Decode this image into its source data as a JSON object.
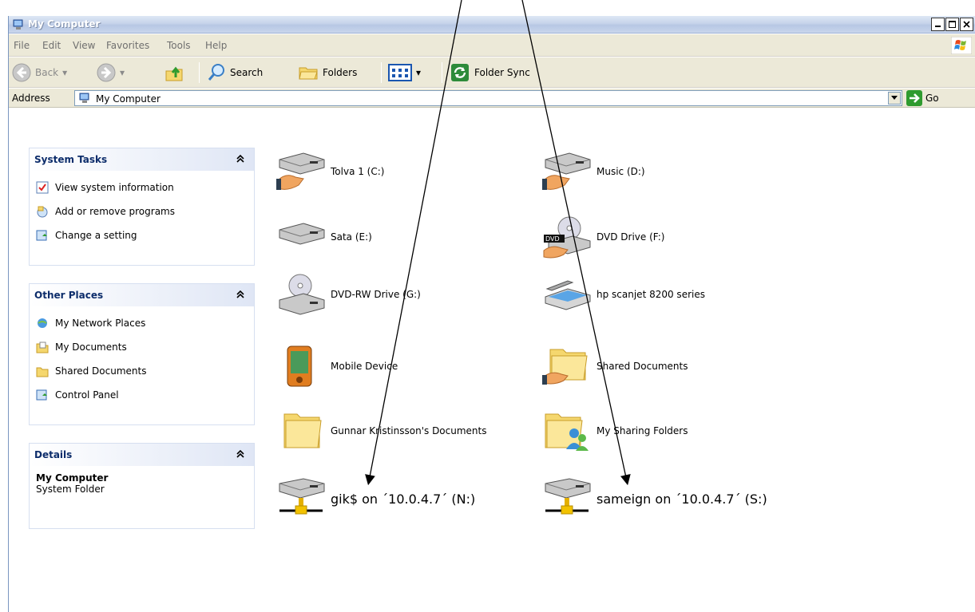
{
  "window": {
    "title": "My Computer"
  },
  "menu": [
    "File",
    "Edit",
    "View",
    "Favorites",
    "Tools",
    "Help"
  ],
  "toolbar": {
    "back": "Back",
    "search": "Search",
    "folders": "Folders",
    "folder_sync": "Folder Sync"
  },
  "address": {
    "label": "Address",
    "value": "My Computer",
    "go": "Go"
  },
  "system_tasks": {
    "title": "System Tasks",
    "items": [
      "View system information",
      "Add or remove programs",
      "Change a setting"
    ]
  },
  "other_places": {
    "title": "Other Places",
    "items": [
      "My Network Places",
      "My Documents",
      "Shared Documents",
      "Control Panel"
    ]
  },
  "details": {
    "title": "Details",
    "name": "My Computer",
    "type": "System Folder"
  },
  "items": [
    {
      "label": "Tolva 1  (C:)",
      "icon": "shared-drive-icon"
    },
    {
      "label": "Music  (D:)",
      "icon": "shared-drive-icon"
    },
    {
      "label": "Sata (E:)",
      "icon": "drive-icon"
    },
    {
      "label": "DVD Drive (F:)",
      "icon": "dvd-drive-icon"
    },
    {
      "label": "DVD-RW Drive (G:)",
      "icon": "cd-drive-icon"
    },
    {
      "label": "hp scanjet 8200 series",
      "icon": "scanner-icon"
    },
    {
      "label": "Mobile Device",
      "icon": "pda-icon"
    },
    {
      "label": "Shared Documents",
      "icon": "shared-folder-icon"
    },
    {
      "label": "Gunnar Kristinsson's Documents",
      "icon": "folder-icon"
    },
    {
      "label": "My Sharing Folders",
      "icon": "sharing-folder-icon"
    },
    {
      "label": "gik$ on ´10.0.4.7´ (N:)",
      "icon": "network-drive-icon"
    },
    {
      "label": "sameign on ´10.0.4.7´ (S:)",
      "icon": "network-drive-icon"
    }
  ]
}
